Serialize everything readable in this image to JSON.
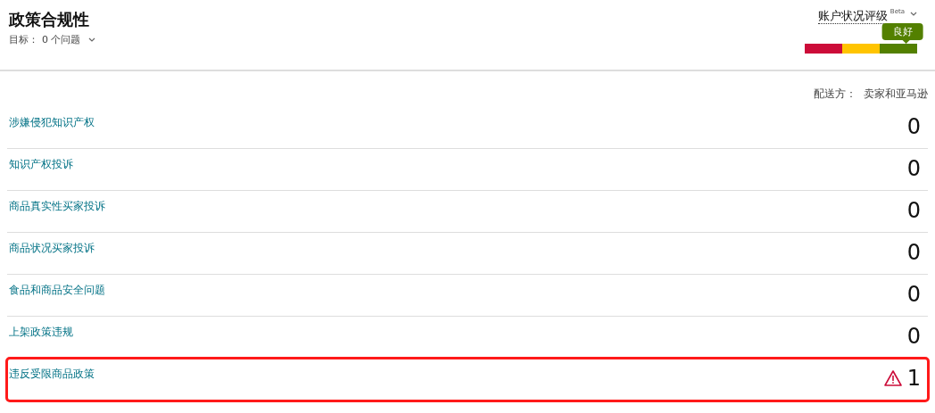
{
  "header": {
    "title": "政策合规性",
    "target_label": "目标：",
    "target_value": "0 个问题"
  },
  "health": {
    "label": "账户状况评级",
    "tag": "Beta",
    "status": "良好",
    "segments": [
      {
        "color": "#cc0c39",
        "selected": false
      },
      {
        "color": "#ffc400",
        "selected": false
      },
      {
        "color": "#538000",
        "selected": true
      }
    ]
  },
  "fulfilment": "配送方：  卖家和亚马逊",
  "rows": [
    {
      "label": "涉嫌侵犯知识产权",
      "count": "0",
      "warning": false,
      "highlighted": false
    },
    {
      "label": "知识产权投诉",
      "count": "0",
      "warning": false,
      "highlighted": false
    },
    {
      "label": "商品真实性买家投诉",
      "count": "0",
      "warning": false,
      "highlighted": false
    },
    {
      "label": "商品状况买家投诉",
      "count": "0",
      "warning": false,
      "highlighted": false
    },
    {
      "label": "食品和商品安全问题",
      "count": "0",
      "warning": false,
      "highlighted": false
    },
    {
      "label": "上架政策违规",
      "count": "0",
      "warning": false,
      "highlighted": false
    },
    {
      "label": "违反受限商品政策",
      "count": "1",
      "warning": true,
      "highlighted": true
    }
  ]
}
